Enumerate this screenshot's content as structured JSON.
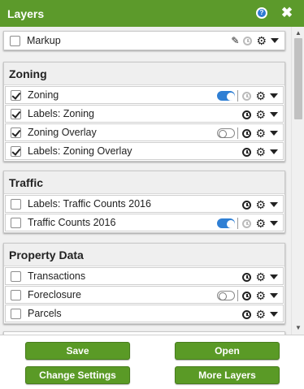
{
  "header": {
    "title": "Layers"
  },
  "icons": {
    "help": "help-icon",
    "close": "close-icon",
    "close_glyph": "✖",
    "help_glyph": "?"
  },
  "markup": {
    "label": "Markup",
    "checked": false
  },
  "groups": [
    {
      "title": "Zoning",
      "layers": [
        {
          "label": "Zoning",
          "checked": true,
          "toggle": "on"
        },
        {
          "label": "Labels: Zoning",
          "checked": true
        },
        {
          "label": "Zoning Overlay",
          "checked": true,
          "toggle": "off"
        },
        {
          "label": "Labels: Zoning Overlay",
          "checked": true
        }
      ]
    },
    {
      "title": "Traffic",
      "layers": [
        {
          "label": "Labels: Traffic Counts 2016",
          "checked": false
        },
        {
          "label": "Traffic Counts 2016",
          "checked": false,
          "toggle": "on"
        }
      ]
    },
    {
      "title": "Property Data",
      "layers": [
        {
          "label": "Transactions",
          "checked": false
        },
        {
          "label": "Foreclosure",
          "checked": false,
          "toggle": "off"
        },
        {
          "label": "Parcels",
          "checked": false
        }
      ]
    }
  ],
  "footer": {
    "save": "Save",
    "open": "Open",
    "change_settings": "Change Settings",
    "more_layers": "More Layers"
  },
  "colors": {
    "header": "#5c9a2b",
    "button": "#5a9a26",
    "toggle_on": "#2f7fd4"
  }
}
